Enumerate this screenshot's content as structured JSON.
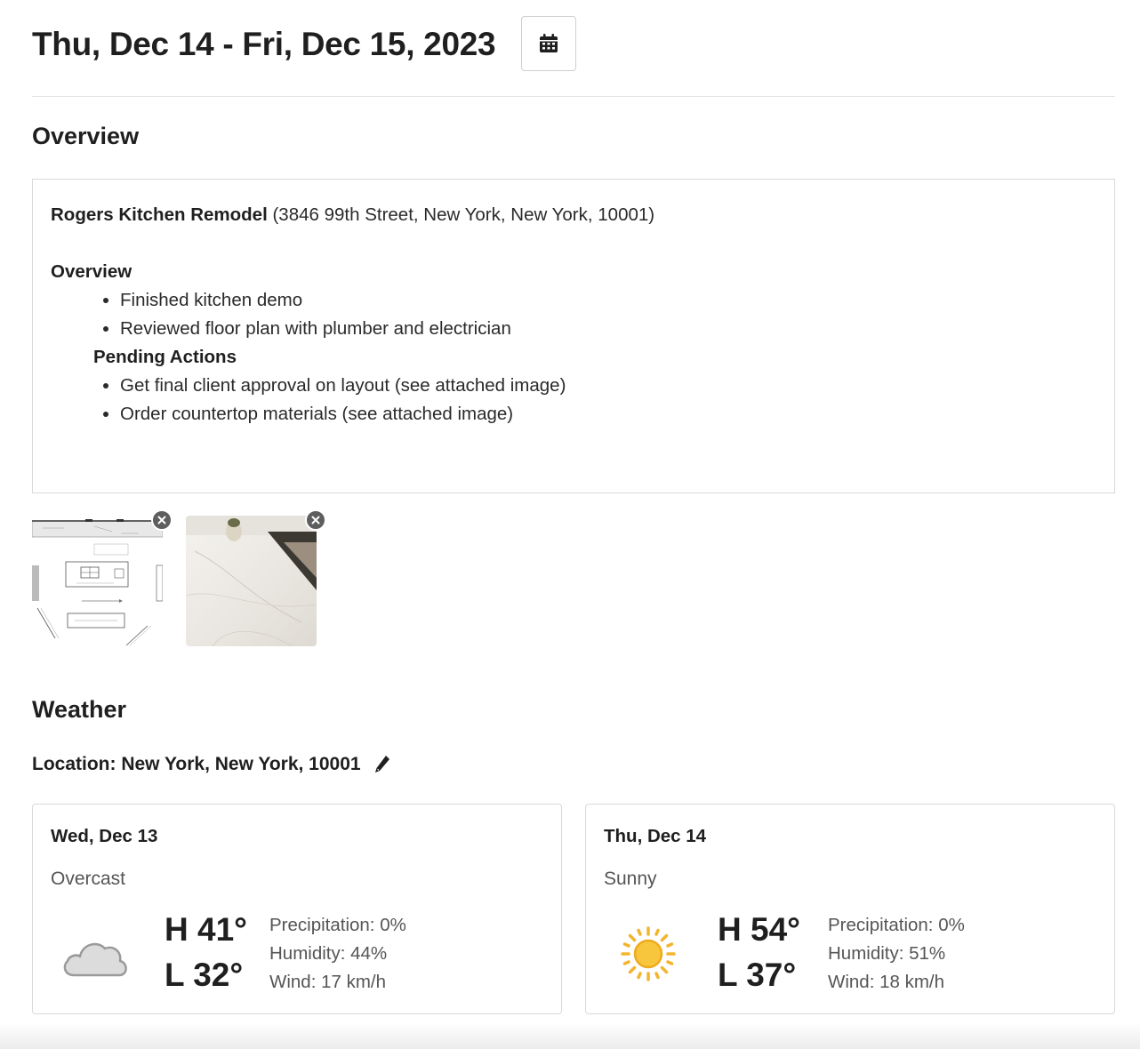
{
  "header": {
    "date_range": "Thu, Dec 14 - Fri, Dec 15, 2023",
    "calendar_icon": "calendar-icon"
  },
  "overview": {
    "section_title": "Overview",
    "project_name": "Rogers Kitchen Remodel",
    "project_address": " (3846 99th Street, New York, New York, 10001)",
    "overview_heading": "Overview",
    "overview_items": [
      "Finished kitchen demo",
      "Reviewed floor plan with plumber and electrician"
    ],
    "pending_heading": "Pending Actions",
    "pending_items": [
      "Get final client approval on layout (see attached image)",
      "Order countertop materials (see attached image)"
    ]
  },
  "attachments": [
    {
      "kind": "floor-plan-image",
      "remove_icon": "close-icon"
    },
    {
      "kind": "countertop-photo",
      "remove_icon": "close-icon"
    }
  ],
  "weather": {
    "section_title": "Weather",
    "location_label": "Location: New York, New York, 10001",
    "edit_icon": "pencil-icon",
    "days": [
      {
        "date": "Wed, Dec 13",
        "condition": "Overcast",
        "icon": "cloud-icon",
        "high": "H 41°",
        "low": "L 32°",
        "precipitation": "Precipitation: 0%",
        "humidity": "Humidity: 44%",
        "wind": "Wind: 17 km/h"
      },
      {
        "date": "Thu, Dec 14",
        "condition": "Sunny",
        "icon": "sun-icon",
        "high": "H 54°",
        "low": "L 37°",
        "precipitation": "Precipitation: 0%",
        "humidity": "Humidity: 51%",
        "wind": "Wind: 18 km/h"
      }
    ]
  }
}
